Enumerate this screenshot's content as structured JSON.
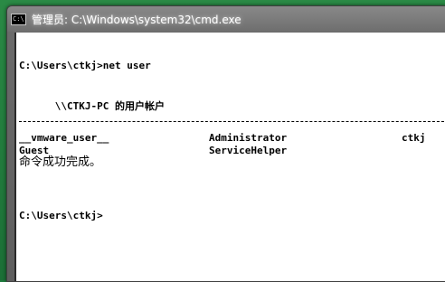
{
  "window": {
    "title": "管理员: C:\\Windows\\system32\\cmd.exe",
    "icon_text": "C:\\"
  },
  "console": {
    "command_line": "C:\\Users\\ctkj>net user",
    "header_line": "\\\\CTKJ-PC 的用户帐户",
    "separator": "-------------------------------------------------------------------------------",
    "accounts": [
      [
        "__vmware_user__",
        "Administrator",
        "ctkj"
      ],
      [
        "Guest",
        "ServiceHelper",
        ""
      ]
    ],
    "result": "命令成功完成。",
    "prompt": "C:\\Users\\ctkj>"
  }
}
